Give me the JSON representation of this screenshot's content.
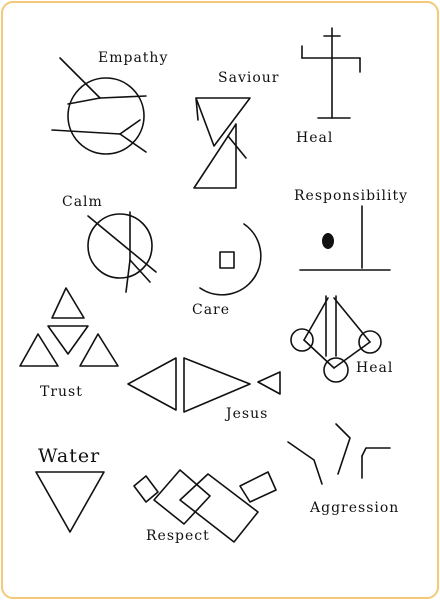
{
  "symbols": {
    "empathy": "Empathy",
    "saviour": "Saviour",
    "heal_cross": "Heal",
    "calm": "Calm",
    "responsibility": "Responsibility",
    "care": "Care",
    "trust": "Trust",
    "heal_circles": "Heal",
    "jesus": "Jesus",
    "water": "Water",
    "respect": "Respect",
    "aggression": "Aggression"
  },
  "colors": {
    "border": "#f3c87a",
    "ink": "#111111"
  }
}
